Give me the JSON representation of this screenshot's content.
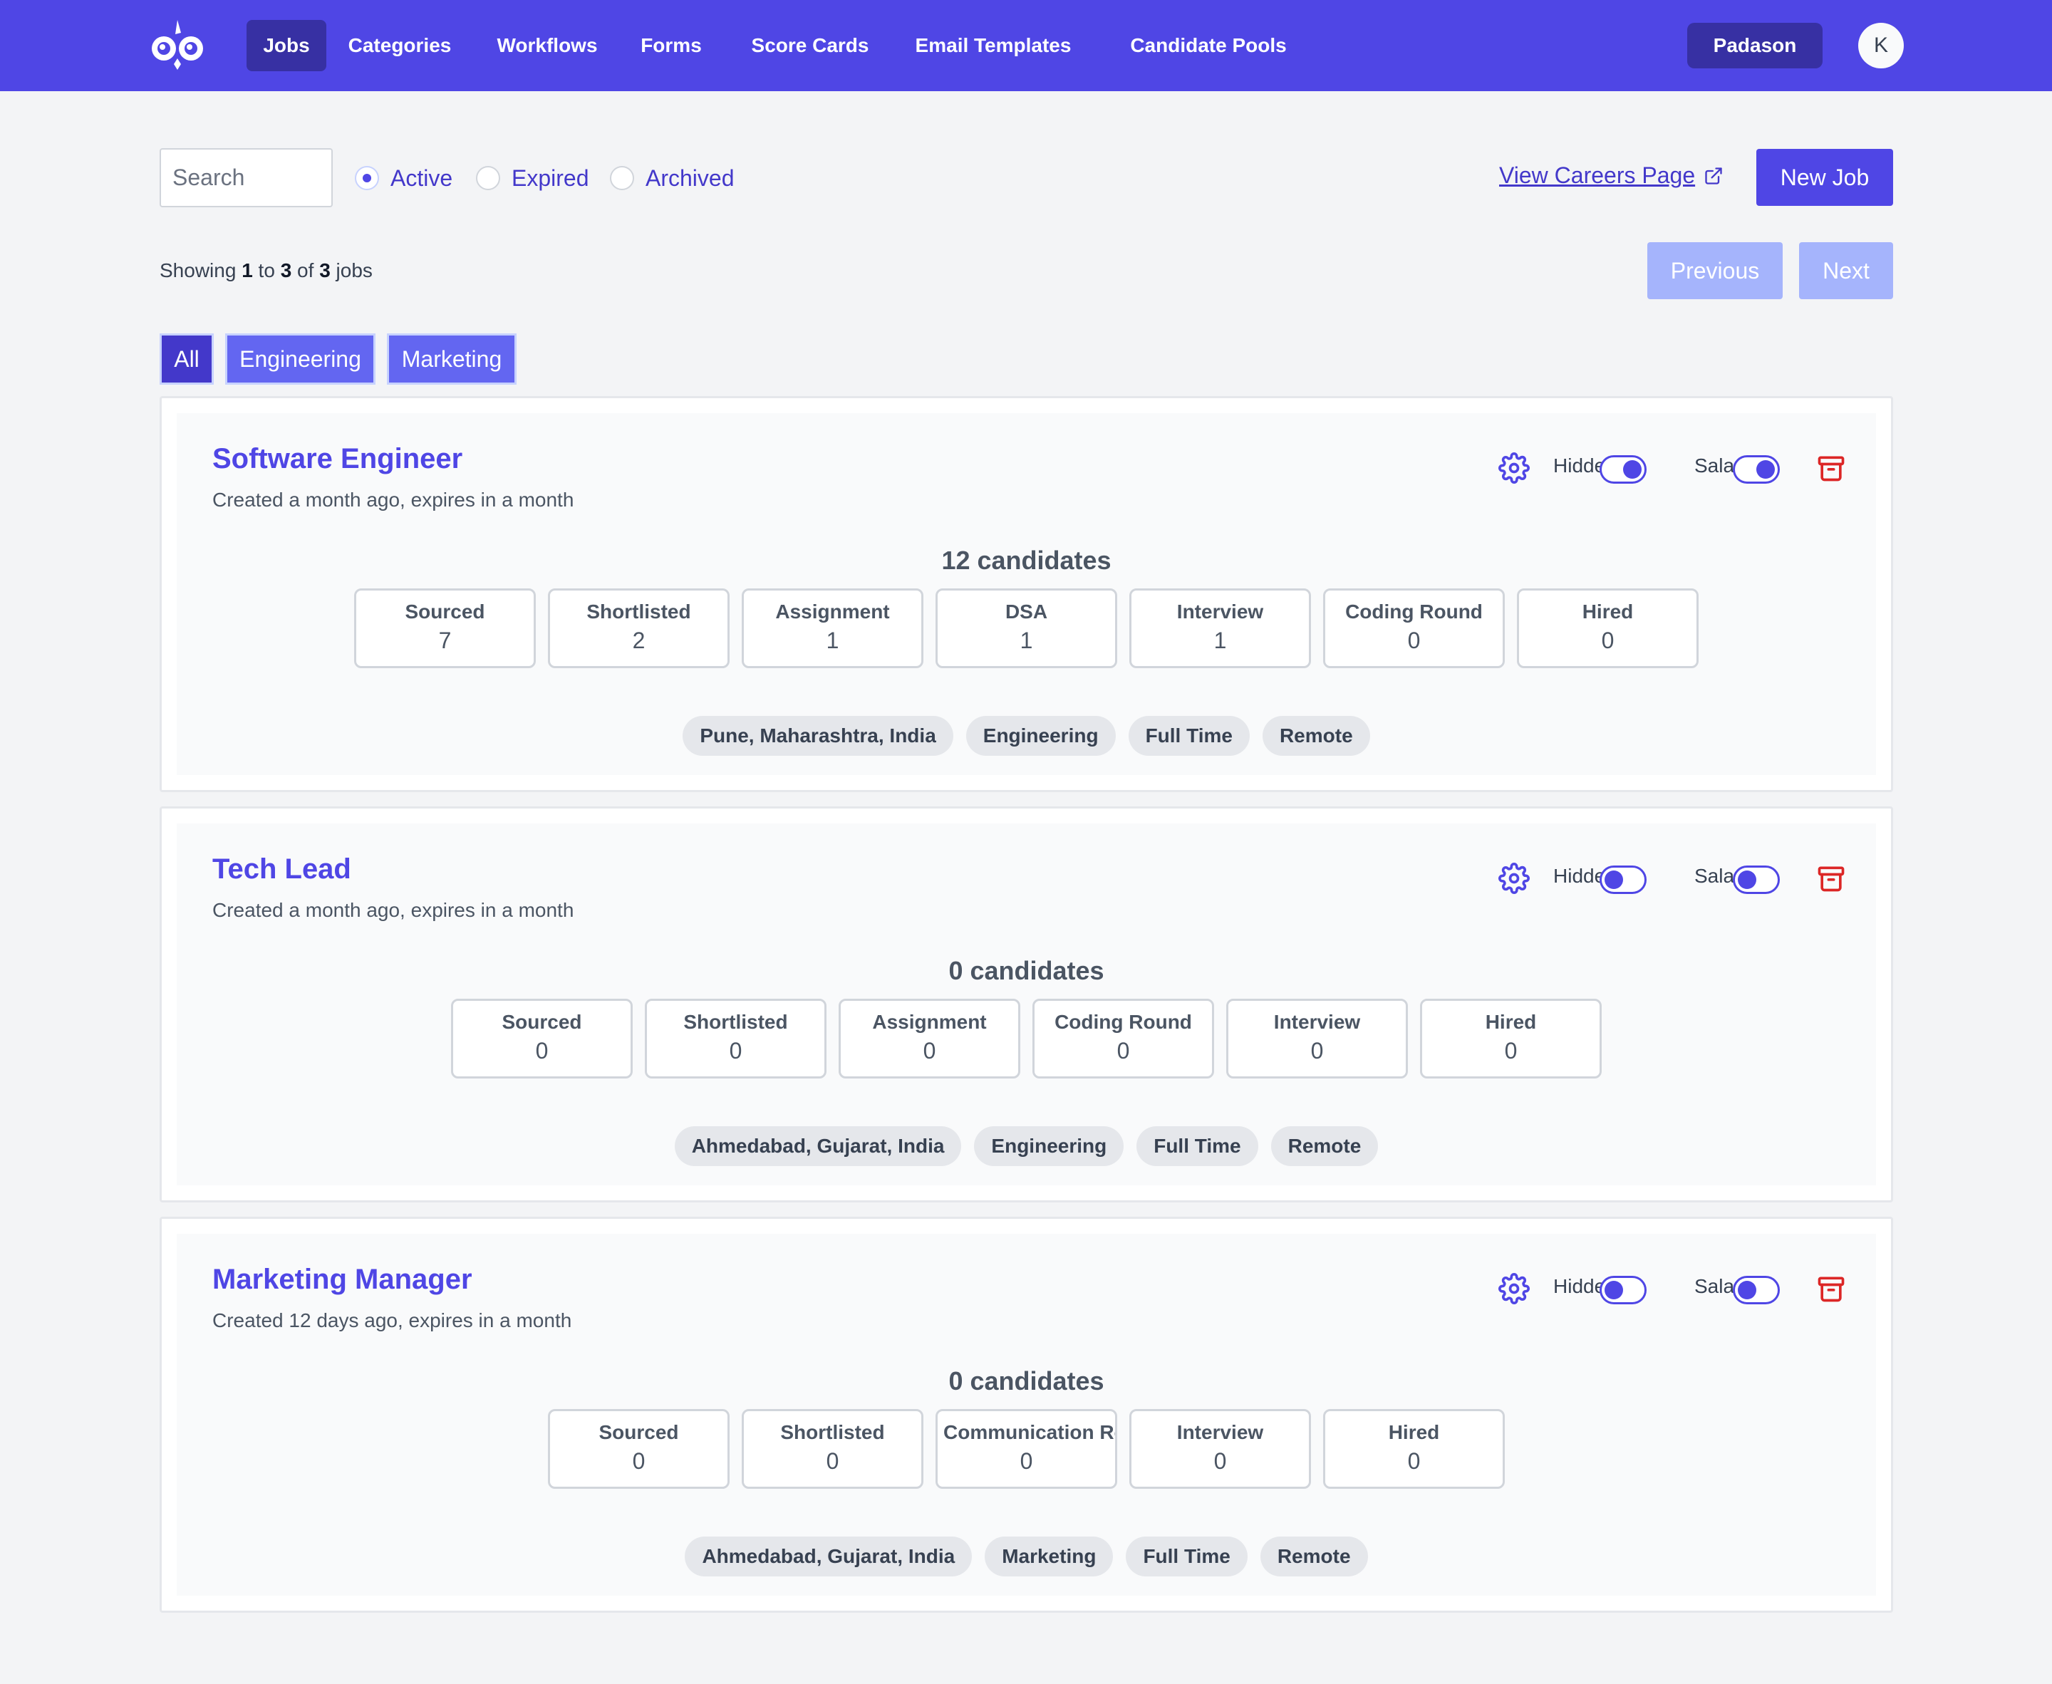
{
  "nav": {
    "items": [
      "Jobs",
      "Categories",
      "Workflows",
      "Forms",
      "Score Cards",
      "Email Templates",
      "Candidate Pools"
    ],
    "active": "Jobs",
    "org_label": "Padason",
    "avatar_initial": "K"
  },
  "toolbar": {
    "search_placeholder": "Search",
    "status_filters": [
      {
        "label": "Active",
        "checked": true
      },
      {
        "label": "Expired",
        "checked": false
      },
      {
        "label": "Archived",
        "checked": false
      }
    ],
    "careers_link": "View Careers Page",
    "new_job_label": "New Job"
  },
  "pagination": {
    "showing_prefix": "Showing",
    "from": "1",
    "to_word": "to",
    "to": "3",
    "of_word": "of",
    "total": "3",
    "suffix": "jobs",
    "previous_label": "Previous",
    "next_label": "Next"
  },
  "categories": [
    "All",
    "Engineering",
    "Marketing"
  ],
  "active_category": "All",
  "labels": {
    "hidden": "Hidden",
    "salary": "Salary"
  },
  "colors": {
    "accent": "#4f46e5",
    "nav_active": "#3730a3",
    "danger": "#dc2626"
  },
  "jobs": [
    {
      "title": "Software Engineer",
      "subtitle": "Created a month ago, expires in a month",
      "hidden_on": true,
      "salary_on": true,
      "candidates_label": "12 candidates",
      "stages": [
        {
          "name": "Sourced",
          "count": "7"
        },
        {
          "name": "Shortlisted",
          "count": "2"
        },
        {
          "name": "Assignment",
          "count": "1"
        },
        {
          "name": "DSA",
          "count": "1"
        },
        {
          "name": "Interview",
          "count": "1"
        },
        {
          "name": "Coding Round",
          "count": "0"
        },
        {
          "name": "Hired",
          "count": "0"
        }
      ],
      "tags": [
        "Pune, Maharashtra, India",
        "Engineering",
        "Full Time",
        "Remote"
      ]
    },
    {
      "title": "Tech Lead",
      "subtitle": "Created a month ago, expires in a month",
      "hidden_on": false,
      "salary_on": false,
      "candidates_label": "0 candidates",
      "stages": [
        {
          "name": "Sourced",
          "count": "0"
        },
        {
          "name": "Shortlisted",
          "count": "0"
        },
        {
          "name": "Assignment",
          "count": "0"
        },
        {
          "name": "Coding Round",
          "count": "0"
        },
        {
          "name": "Interview",
          "count": "0"
        },
        {
          "name": "Hired",
          "count": "0"
        }
      ],
      "tags": [
        "Ahmedabad, Gujarat, India",
        "Engineering",
        "Full Time",
        "Remote"
      ]
    },
    {
      "title": "Marketing Manager",
      "subtitle": "Created 12 days ago, expires in a month",
      "hidden_on": false,
      "salary_on": false,
      "candidates_label": "0 candidates",
      "stages": [
        {
          "name": "Sourced",
          "count": "0"
        },
        {
          "name": "Shortlisted",
          "count": "0"
        },
        {
          "name": "Communication Round",
          "count": "0"
        },
        {
          "name": "Interview",
          "count": "0"
        },
        {
          "name": "Hired",
          "count": "0"
        }
      ],
      "tags": [
        "Ahmedabad, Gujarat, India",
        "Marketing",
        "Full Time",
        "Remote"
      ]
    }
  ]
}
